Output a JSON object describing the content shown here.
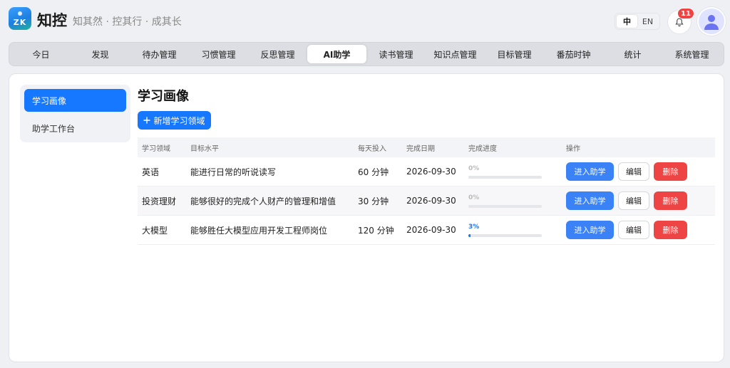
{
  "brand": {
    "logo_text": "ZK",
    "title": "知控",
    "slogan": "知其然 · 控其行 · 成其长"
  },
  "header": {
    "lang_options": [
      "中",
      "EN"
    ],
    "notification_count": "11"
  },
  "nav": {
    "items": [
      {
        "label": "今日"
      },
      {
        "label": "发现"
      },
      {
        "label": "待办管理"
      },
      {
        "label": "习惯管理"
      },
      {
        "label": "反思管理"
      },
      {
        "label": "AI助学"
      },
      {
        "label": "读书管理"
      },
      {
        "label": "知识点管理"
      },
      {
        "label": "目标管理"
      },
      {
        "label": "番茄时钟"
      },
      {
        "label": "统计"
      },
      {
        "label": "系统管理"
      }
    ],
    "active_index": 5
  },
  "sidebar": {
    "items": [
      {
        "label": "学习画像"
      },
      {
        "label": "助学工作台"
      }
    ]
  },
  "main": {
    "title": "学习画像",
    "add_button": "新增学习领域",
    "table": {
      "headers": [
        "学习领域",
        "目标水平",
        "每天投入",
        "完成日期",
        "完成进度",
        "操作"
      ],
      "rows": [
        {
          "domain": "英语",
          "goal": "能进行日常的听说读写",
          "daily": "60 分钟",
          "date": "2026-09-30",
          "progress_label": "0%",
          "progress": 0
        },
        {
          "domain": "投资理财",
          "goal": "能够很好的完成个人财产的管理和增值",
          "daily": "30 分钟",
          "date": "2026-09-30",
          "progress_label": "0%",
          "progress": 0
        },
        {
          "domain": "大模型",
          "goal": "能够胜任大模型应用开发工程师岗位",
          "daily": "120 分钟",
          "date": "2026-09-30",
          "progress_label": "3%",
          "progress": 3
        }
      ],
      "actions": {
        "enter": "进入助学",
        "edit": "编辑",
        "delete": "删除"
      }
    }
  },
  "colors": {
    "primary": "#1677ff",
    "danger": "#ef4444"
  }
}
